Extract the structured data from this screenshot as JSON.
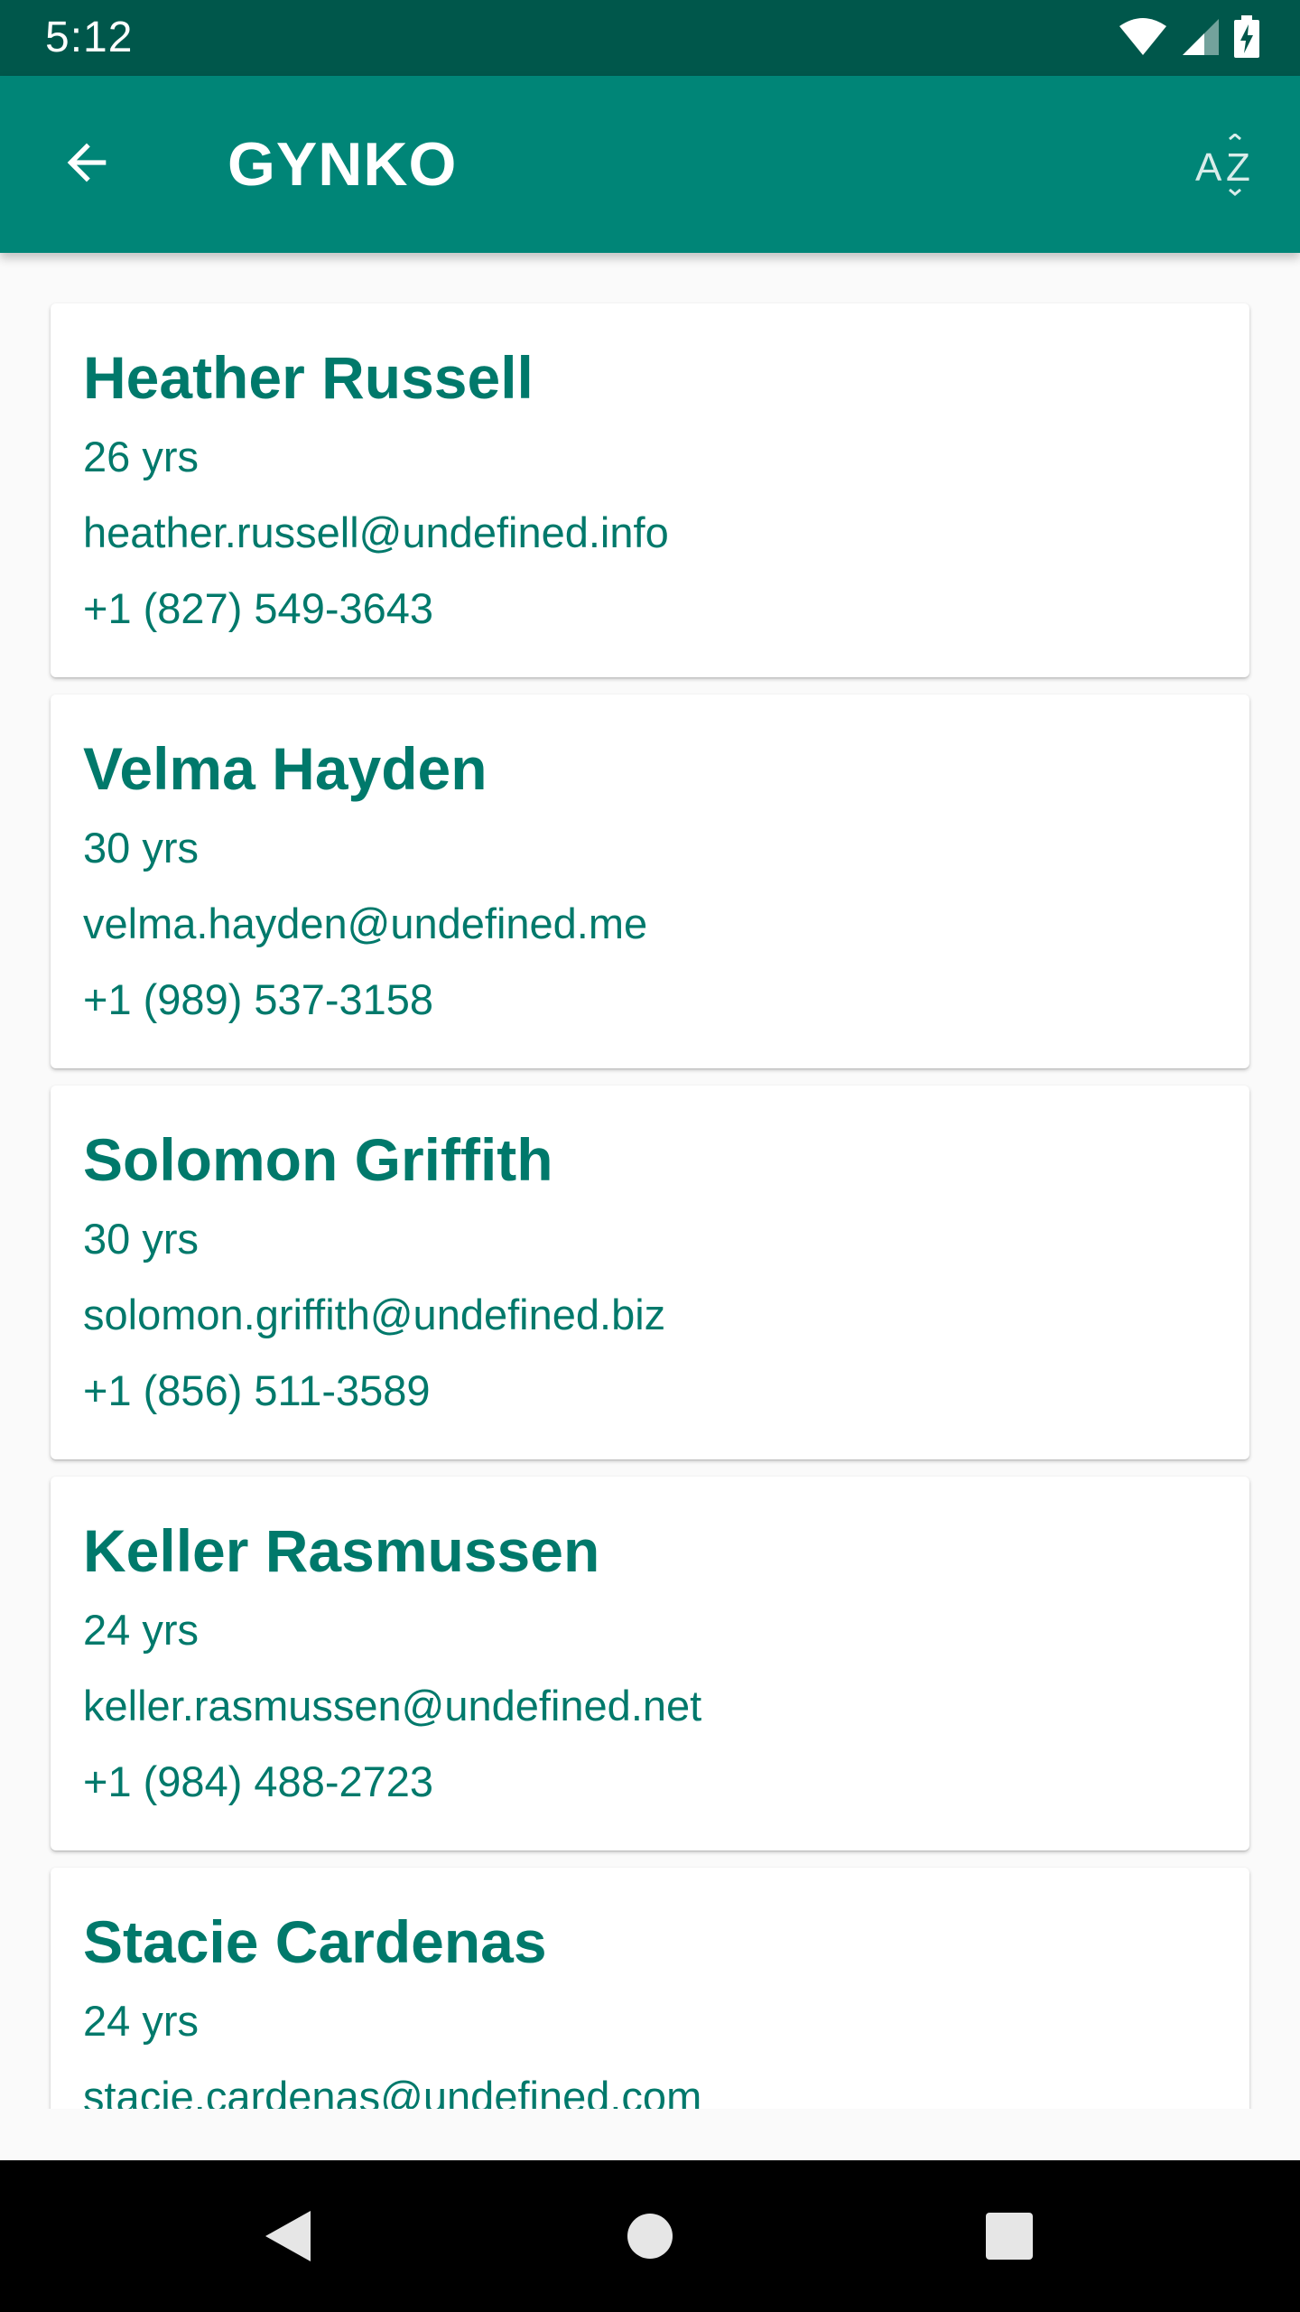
{
  "status_bar": {
    "time": "5:12",
    "icons": [
      "wifi-icon",
      "cell-signal-icon",
      "battery-charging-icon"
    ]
  },
  "app_bar": {
    "title": "GYNKO",
    "back_icon": "arrow-back-icon",
    "sort_icon": "sort-az-icon"
  },
  "contacts": [
    {
      "name": "Heather Russell",
      "age": "26 yrs",
      "email": "heather.russell@undefined.info",
      "phone": "+1 (827) 549-3643"
    },
    {
      "name": "Velma Hayden",
      "age": "30 yrs",
      "email": "velma.hayden@undefined.me",
      "phone": "+1 (989) 537-3158"
    },
    {
      "name": "Solomon Griffith",
      "age": "30 yrs",
      "email": "solomon.griffith@undefined.biz",
      "phone": "+1 (856) 511-3589"
    },
    {
      "name": "Keller Rasmussen",
      "age": "24 yrs",
      "email": "keller.rasmussen@undefined.net",
      "phone": "+1 (984) 488-2723"
    },
    {
      "name": "Stacie Cardenas",
      "age": "24 yrs",
      "email": "stacie.cardenas@undefined.com",
      "phone": ""
    }
  ],
  "nav_bar": {
    "icons": [
      "nav-back-icon",
      "nav-home-icon",
      "nav-recents-icon"
    ]
  },
  "colors": {
    "status_bar": "#00574b",
    "primary": "#008577",
    "text_accent": "#00796b",
    "background": "#fafafa"
  }
}
